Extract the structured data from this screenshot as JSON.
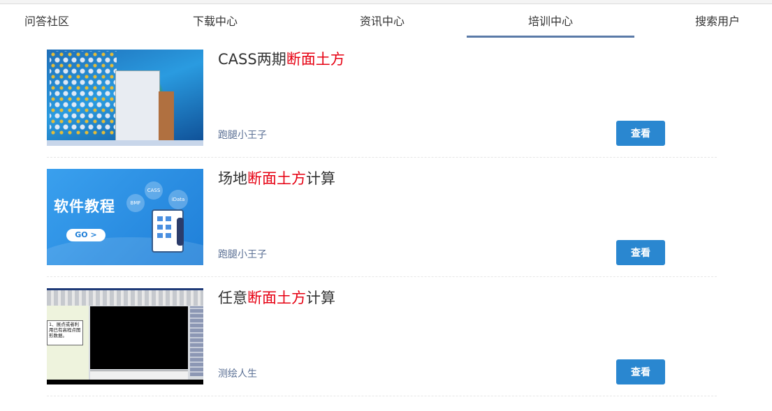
{
  "nav": {
    "tabs": [
      {
        "label": "问答社区",
        "active": false
      },
      {
        "label": "下载中心",
        "active": false
      },
      {
        "label": "资讯中心",
        "active": false
      },
      {
        "label": "培训中心",
        "active": true
      },
      {
        "label": "搜索用户",
        "active": false
      }
    ],
    "active_color": "#5a7aa8"
  },
  "results": [
    {
      "title_before": "CASS两期",
      "title_highlight": "断面土方",
      "title_after": "",
      "author": "跑腿小王子",
      "button_label": "查看",
      "thumbnail": "windows-desktop-screenshot"
    },
    {
      "title_before": "场地",
      "title_highlight": "断面土方",
      "title_after": "计算",
      "author": "跑腿小王子",
      "button_label": "查看",
      "thumbnail": "software-tutorial-banner",
      "thumb_text": {
        "heading": "软件教程",
        "go": "GO >",
        "tags": [
          "BMF",
          "CASS",
          "iData"
        ]
      }
    },
    {
      "title_before": "任意",
      "title_highlight": "断面土方",
      "title_after": "计算",
      "author": "测绘人生",
      "button_label": "查看",
      "thumbnail": "cad-software-screenshot",
      "thumb_text": {
        "note": "1、展点或者利用已有高程点图形数据。"
      }
    }
  ],
  "colors": {
    "highlight": "#e60012",
    "button": "#2a87d0",
    "author": "#5a6f94"
  }
}
